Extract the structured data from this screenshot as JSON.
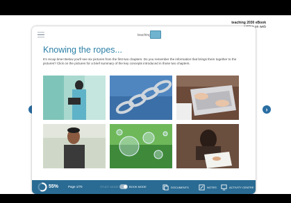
{
  "brand": {
    "line1": "teaching 2030 eBook",
    "line2": "writing on web"
  },
  "header": {
    "logo_text": "teaching"
  },
  "page": {
    "title": "Knowing the ropes...",
    "intro": "It's recap time! Below you'll see six pictures from the first two chapters. Do you remember the information that brings them together to the pictures? Click on the pictures for a brief summary of the key concepts introduced in those two chapters."
  },
  "images": [
    {
      "name": "woman-with-laptop-image"
    },
    {
      "name": "chain-links-image"
    },
    {
      "name": "hands-typing-laptop-image"
    },
    {
      "name": "young-man-portrait-image"
    },
    {
      "name": "soap-bubbles-image"
    },
    {
      "name": "woman-writing-notes-image"
    }
  ],
  "footer": {
    "progress_percent": "55%",
    "progress_fraction": 0.55,
    "page_label": "Page 1/70",
    "study_mode_label": "STUDY MODE",
    "book_mode_label": "BOOK MODE",
    "documents_label": "DOCUMENTS",
    "notes_label": "NOTES",
    "activity_centre_label": "ACTIVITY CENTRE"
  },
  "colors": {
    "title": "#2b7fa6",
    "footer": "#2a6b93",
    "nav_arrow": "#2a6ea3"
  }
}
